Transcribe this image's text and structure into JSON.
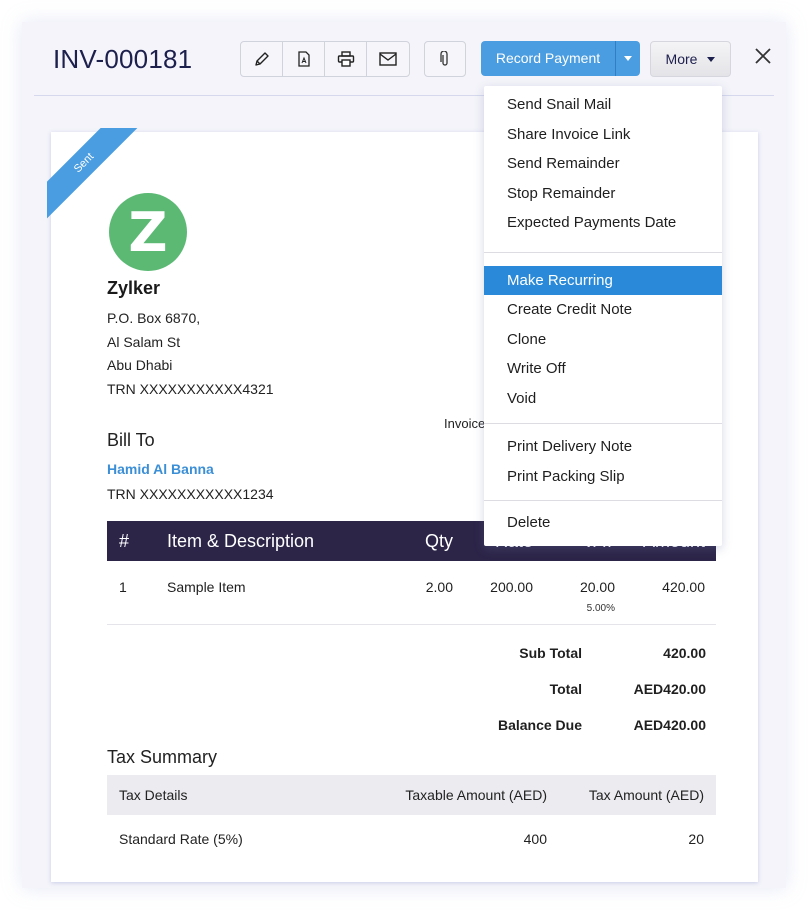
{
  "header": {
    "title": "INV-000181",
    "toolbar_icons": [
      {
        "name": "edit",
        "icon": "pencil-icon"
      },
      {
        "name": "pdf",
        "icon": "pdf-icon"
      },
      {
        "name": "print",
        "icon": "printer-icon"
      },
      {
        "name": "email",
        "icon": "envelope-icon"
      }
    ],
    "attach_icon": "paperclip-icon",
    "record_payment_label": "Record Payment",
    "more_label": "More",
    "close_icon": "close-icon"
  },
  "more_menu": {
    "groups": [
      [
        "Send Snail Mail",
        "Share Invoice Link",
        "Send Remainder",
        "Stop Remainder",
        "Expected Payments Date"
      ],
      [
        "Make Recurring",
        "Create Credit Note",
        "Clone",
        "Write Off",
        "Void"
      ],
      [
        "Print Delivery Note",
        "Print Packing Slip"
      ],
      [
        "Delete"
      ]
    ],
    "highlighted": "Make Recurring"
  },
  "invoice": {
    "status_ribbon": "Sent",
    "logo_letter": "Z",
    "company": {
      "name": "Zylker",
      "address": [
        "P.O. Box 6870,",
        "Al Salam St",
        "Abu Dhabi",
        "TRN XXXXXXXXXXX4321"
      ]
    },
    "invoice_label_partial": "Invoice",
    "bill_to": {
      "label": "Bill To",
      "customer_name": "Hamid Al Banna",
      "trn": "TRN XXXXXXXXXXX1234"
    },
    "items": {
      "columns": [
        "#",
        "Item & Description",
        "Qty",
        "Rate",
        "VAT",
        "Amount"
      ],
      "rows": [
        {
          "num": "1",
          "item": "Sample Item",
          "qty": "2.00",
          "rate": "200.00",
          "vat": "20.00",
          "vat_pct": "5.00%",
          "amount": "420.00"
        }
      ]
    },
    "totals": [
      {
        "label": "Sub Total",
        "value": "420.00"
      },
      {
        "label": "Total",
        "value": "AED420.00"
      },
      {
        "label": "Balance Due",
        "value": "AED420.00"
      }
    ],
    "tax_summary": {
      "title": "Tax Summary",
      "columns": [
        "Tax Details",
        "Taxable Amount (AED)",
        "Tax Amount (AED)"
      ],
      "rows": [
        {
          "details": "Standard Rate (5%)",
          "taxable": "400",
          "tax": "20"
        }
      ]
    }
  },
  "colors": {
    "accent_blue": "#4a9de0",
    "menu_highlight": "#2a8ad9",
    "table_header": "#2c2548",
    "logo_green": "#5bb974",
    "link_blue": "#3b8fd6"
  }
}
